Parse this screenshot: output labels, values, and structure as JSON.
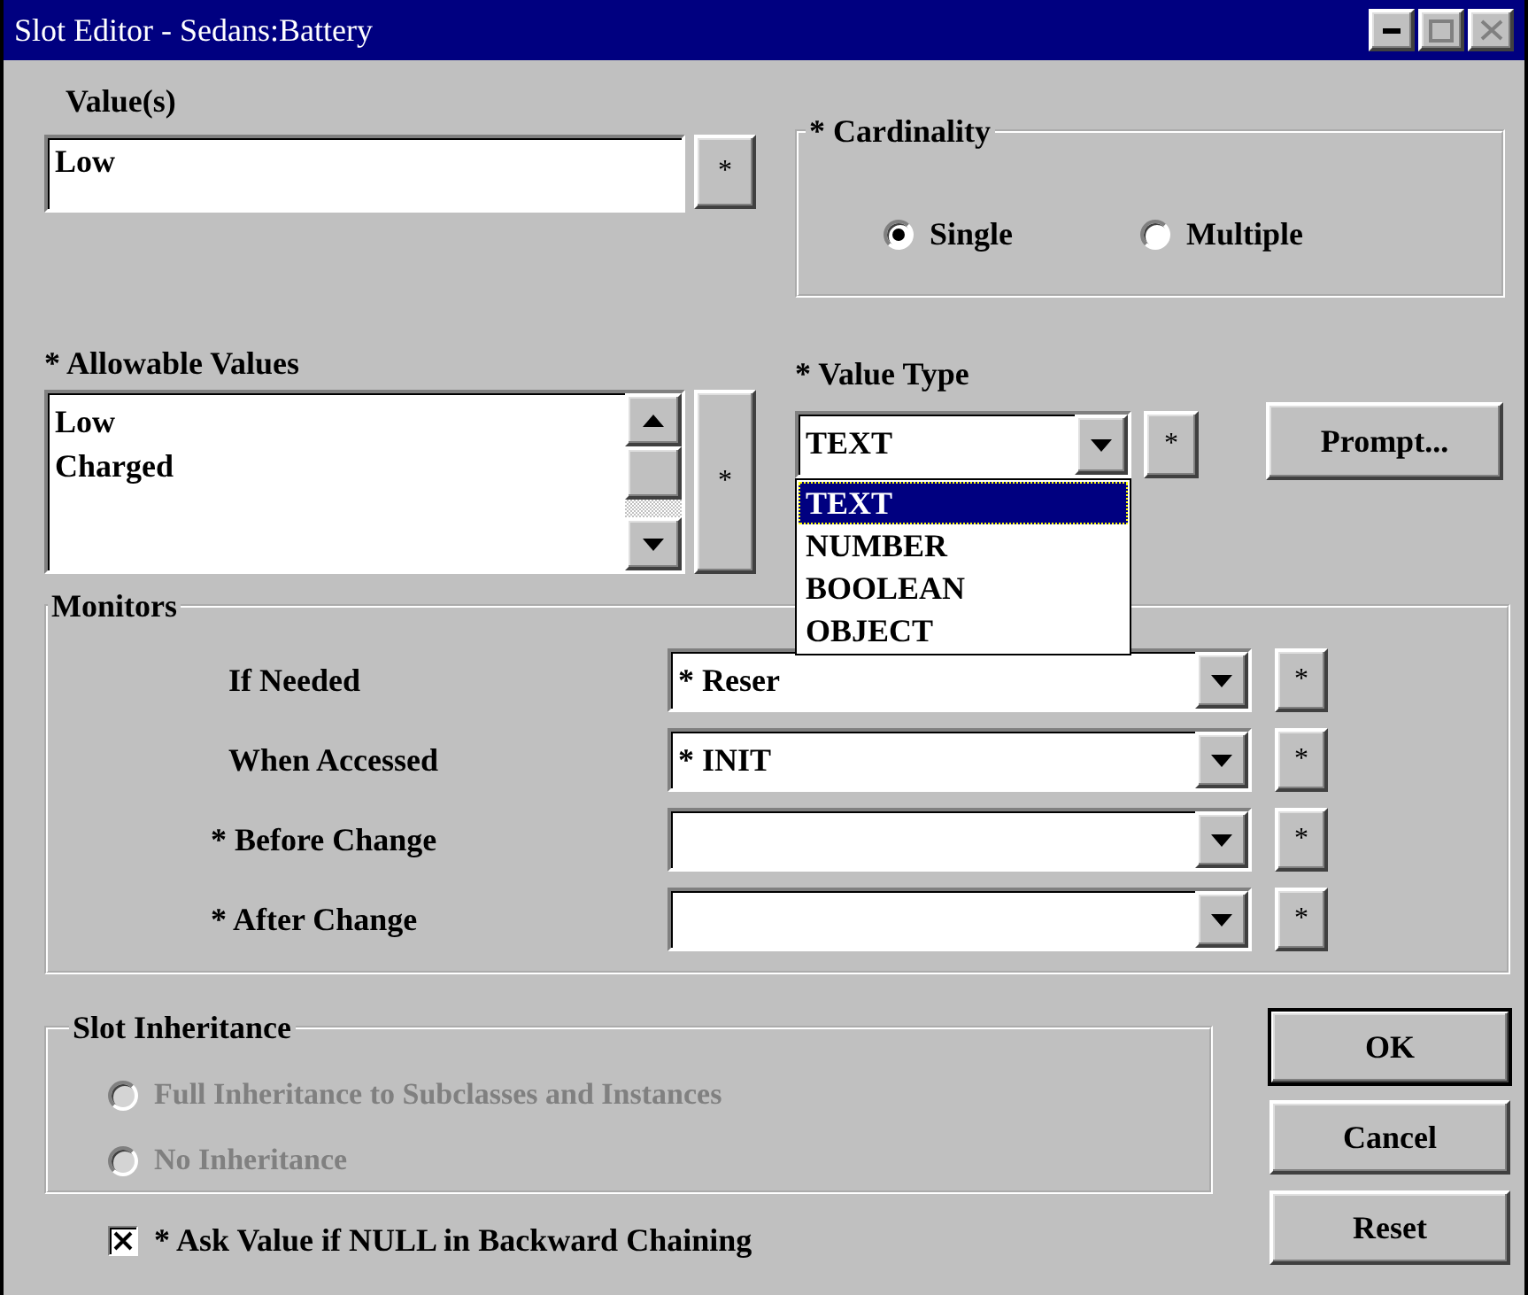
{
  "window": {
    "title": "Slot Editor - Sedans:Battery"
  },
  "values": {
    "label": "Value(s)",
    "value": "Low",
    "button": "*"
  },
  "cardinality": {
    "label": "* Cardinality",
    "options": [
      {
        "label": "Single",
        "selected": true
      },
      {
        "label": "Multiple",
        "selected": false
      }
    ]
  },
  "allowable_values": {
    "label": "* Allowable Values",
    "items": [
      "Low",
      "Charged"
    ],
    "button": "*"
  },
  "value_type": {
    "label": "* Value Type",
    "value": "TEXT",
    "button": "*",
    "expanded": true,
    "options": [
      {
        "label": "TEXT",
        "selected": true
      },
      {
        "label": "NUMBER",
        "selected": false
      },
      {
        "label": "BOOLEAN",
        "selected": false
      },
      {
        "label": "OBJECT",
        "selected": false
      }
    ]
  },
  "prompt_button": "Prompt...",
  "monitors": {
    "label": "Monitors",
    "rows": [
      {
        "label": "If Needed",
        "value": "* Reser",
        "button": "*"
      },
      {
        "label": "When Accessed",
        "value": "* INIT",
        "button": "*"
      },
      {
        "label": "* Before Change",
        "value": "",
        "button": "*"
      },
      {
        "label": "* After Change",
        "value": "",
        "button": "*"
      }
    ]
  },
  "slot_inheritance": {
    "label": "Slot Inheritance",
    "disabled": true,
    "options": [
      {
        "label": "Full Inheritance to Subclasses and Instances",
        "selected": false
      },
      {
        "label": "No Inheritance",
        "selected": false
      }
    ]
  },
  "ask_value": {
    "label": "* Ask Value if NULL in Backward Chaining",
    "checked": true
  },
  "buttons": [
    "OK",
    "Cancel",
    "Reset"
  ]
}
